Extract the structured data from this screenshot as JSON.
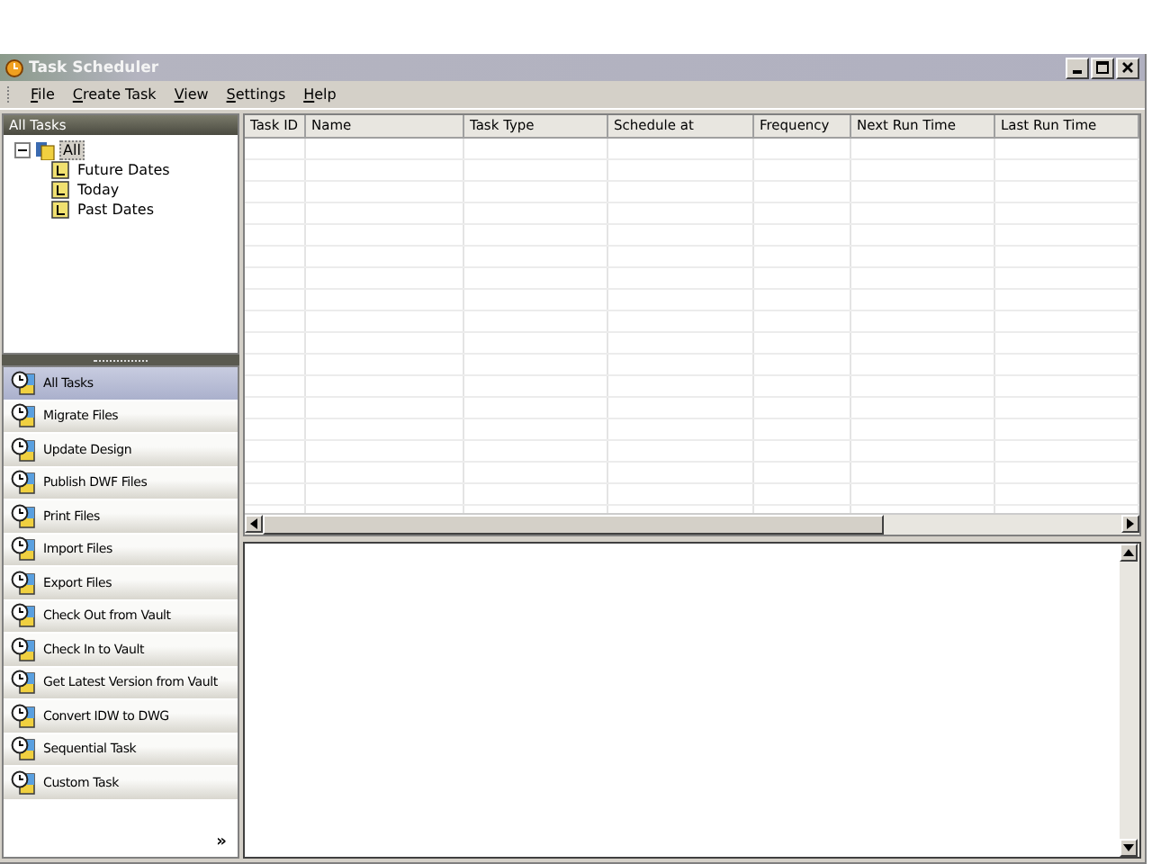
{
  "window": {
    "title": "Task Scheduler"
  },
  "menu": [
    "File",
    "Create Task",
    "View",
    "Settings",
    "Help"
  ],
  "tree_panel": {
    "title": "All Tasks"
  },
  "tree": [
    {
      "label": "All",
      "expanded": true,
      "selected": true,
      "children": [
        {
          "label": "Future Dates",
          "selected": false
        },
        {
          "label": "Today",
          "selected": false
        },
        {
          "label": "Past Dates",
          "selected": false
        }
      ]
    }
  ],
  "task_types": [
    {
      "label": "All Tasks",
      "selected": true
    },
    {
      "label": "Migrate Files",
      "selected": false
    },
    {
      "label": "Update Design",
      "selected": false
    },
    {
      "label": "Publish DWF Files",
      "selected": false
    },
    {
      "label": "Print Files",
      "selected": false
    },
    {
      "label": "Import Files",
      "selected": false
    },
    {
      "label": "Export Files",
      "selected": false
    },
    {
      "label": "Check Out from Vault",
      "selected": false
    },
    {
      "label": "Check In to Vault",
      "selected": false
    },
    {
      "label": "Get Latest Version from Vault",
      "selected": false
    },
    {
      "label": "Convert IDW to DWG",
      "selected": false
    },
    {
      "label": "Sequential Task",
      "selected": false
    },
    {
      "label": "Custom Task",
      "selected": false
    }
  ],
  "more_button": "»",
  "table": {
    "columns": [
      "Task ID",
      "Name",
      "Task Type",
      "Schedule at",
      "Frequency",
      "Next Run Time",
      "Last Run Time"
    ]
  }
}
